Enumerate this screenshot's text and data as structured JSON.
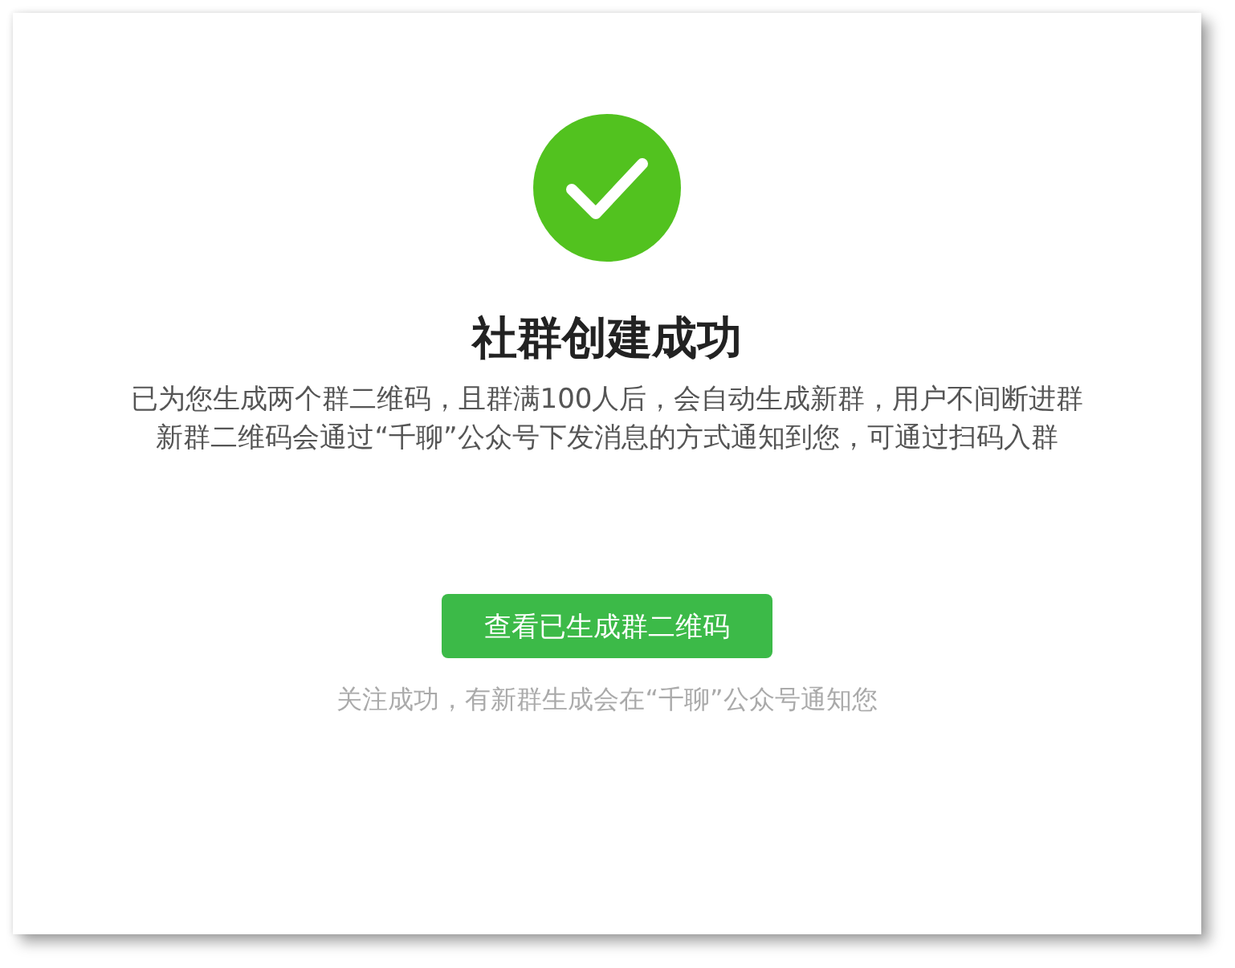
{
  "title": "社群创建成功",
  "messages": [
    "已为您生成两个群二维码，且群满100人后，会自动生成新群，用户不间断进群",
    "新群二维码会通过“千聊”公众号下发消息的方式通知到您，可通过扫码入群"
  ],
  "button": "查看已生成群二维码",
  "note": "关注成功，有新群生成会在“千聊”公众号通知您"
}
